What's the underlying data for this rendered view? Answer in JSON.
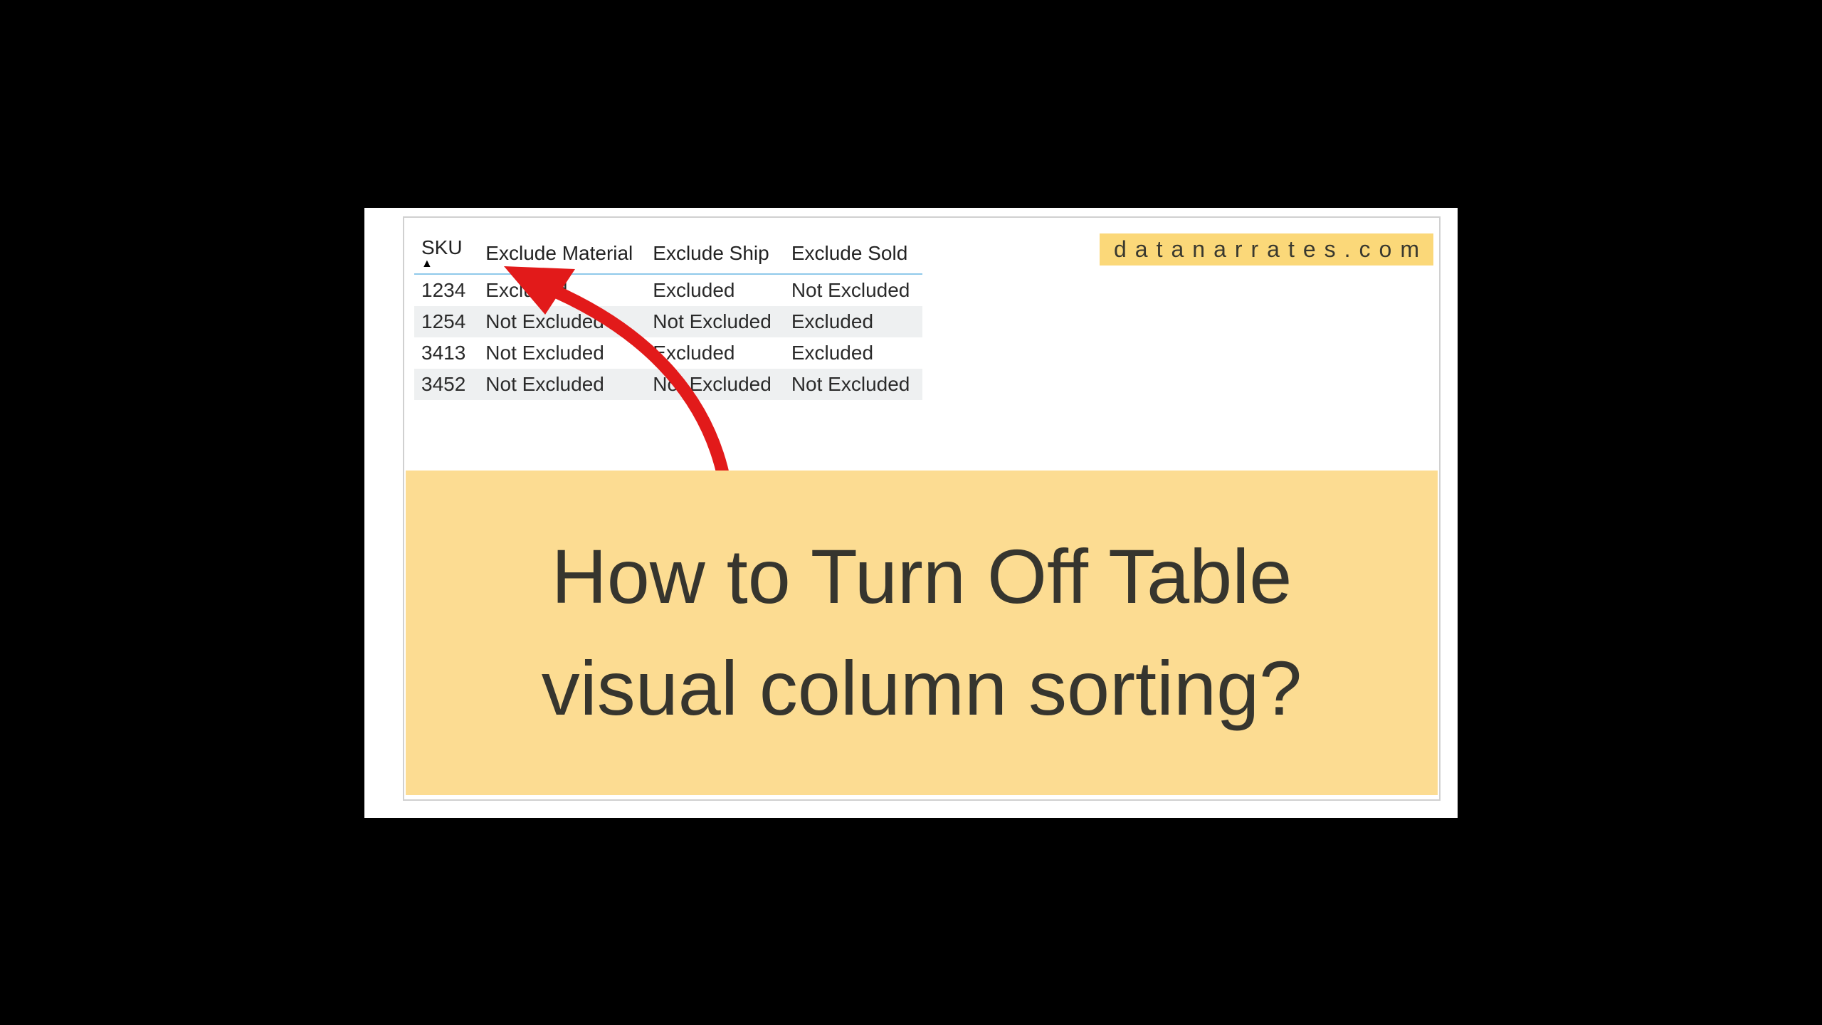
{
  "brand": "datanarrates.com",
  "table": {
    "headers": [
      "SKU",
      "Exclude Material",
      "Exclude Ship",
      "Exclude Sold"
    ],
    "sort_indicator": "▲",
    "rows": [
      {
        "sku": "1234",
        "mat": "Excluded",
        "ship": "Excluded",
        "sold": "Not Excluded"
      },
      {
        "sku": "1254",
        "mat": "Not Excluded",
        "ship": "Not Excluded",
        "sold": "Excluded"
      },
      {
        "sku": "3413",
        "mat": "Not Excluded",
        "ship": "Excluded",
        "sold": "Excluded"
      },
      {
        "sku": "3452",
        "mat": "Not Excluded",
        "ship": "Not Excluded",
        "sold": "Not Excluded"
      }
    ]
  },
  "title_line1": "How to Turn Off Table",
  "title_line2": "visual column sorting?"
}
